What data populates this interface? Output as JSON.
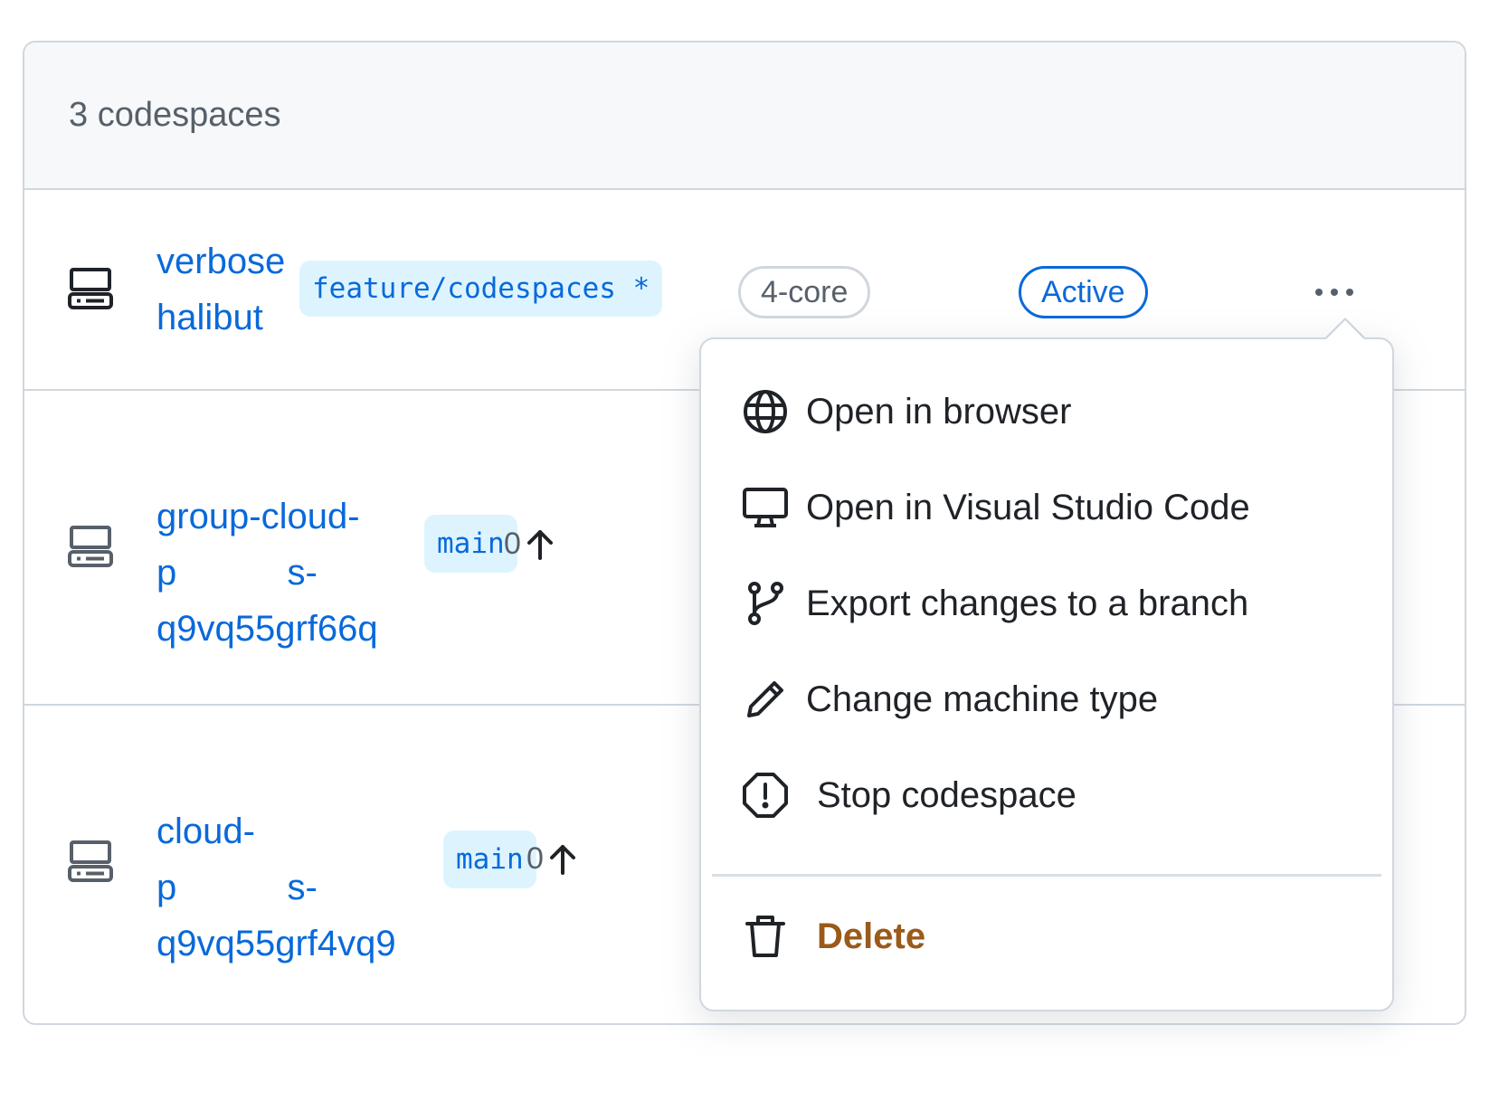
{
  "header": {
    "count_label": "3 codespaces"
  },
  "codespaces": [
    {
      "name_lines": [
        "verbose",
        "halibut"
      ],
      "branch": "feature/codespaces *",
      "machine": "4-core",
      "status": "Active"
    },
    {
      "name_lines": [
        "group-cloud-",
        "p           s-",
        "q9vq55grf66q"
      ],
      "branch": "main",
      "ahead": "0"
    },
    {
      "name_lines": [
        "cloud-",
        "p           s-",
        "q9vq55grf4vq9"
      ],
      "branch": "main",
      "ahead": "0"
    }
  ],
  "menu": {
    "items": [
      {
        "label": "Open in browser",
        "icon": "globe-icon"
      },
      {
        "label": "Open in Visual Studio Code",
        "icon": "desktop-icon"
      },
      {
        "label": "Export changes to a branch",
        "icon": "git-branch-icon"
      },
      {
        "label": "Change machine type",
        "icon": "pencil-icon"
      },
      {
        "label": "Stop codespace",
        "icon": "stop-icon"
      }
    ],
    "delete": {
      "label": "Delete",
      "icon": "trash-icon"
    }
  },
  "colors": {
    "link": "#0969da",
    "muted": "#57606a",
    "branch_bg": "#ddf4ff",
    "border": "#d0d7de",
    "danger": "#9a5a1a"
  }
}
